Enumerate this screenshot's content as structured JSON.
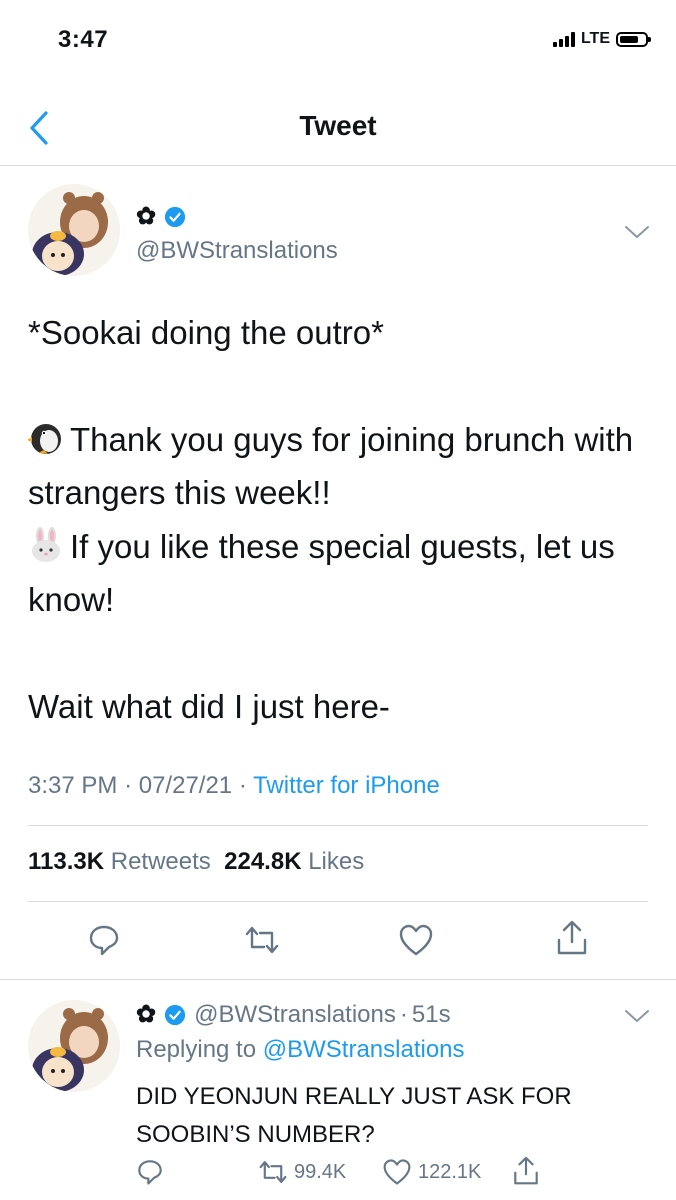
{
  "status_bar": {
    "time": "3:47",
    "network": "LTE"
  },
  "nav": {
    "title": "Tweet"
  },
  "author": {
    "name_glyph": "✿",
    "handle": "@BWStranslations",
    "verified": true
  },
  "tweet": {
    "lines": [
      "*Sookai doing the outro*",
      "",
      "Thank you guys for joining brunch with strangers this week!!",
      "If you like these special guests, let us know!",
      "",
      "Wait what did I just here-"
    ],
    "emoji_line3": "penguin-emoji",
    "emoji_line4": "rabbit-emoji",
    "time": "3:37 PM",
    "date": "07/27/21",
    "source": "Twitter for iPhone",
    "separator": "·"
  },
  "stats": {
    "retweets_count": "113.3K",
    "retweets_label": "Retweets",
    "likes_count": "224.8K",
    "likes_label": "Likes"
  },
  "reply": {
    "name_glyph": "✿",
    "handle": "@BWStranslations",
    "age": "51s",
    "replying_prefix": "Replying to",
    "replying_to": "@BWStranslations",
    "text": "DID YEONJUN REALLY JUST ASK FOR SOOBIN’S NUMBER?",
    "retweets": "99.4K",
    "likes": "122.1K"
  },
  "colors": {
    "accent": "#1d9bf0",
    "muted": "#657786",
    "divider": "#d6dbe0"
  }
}
